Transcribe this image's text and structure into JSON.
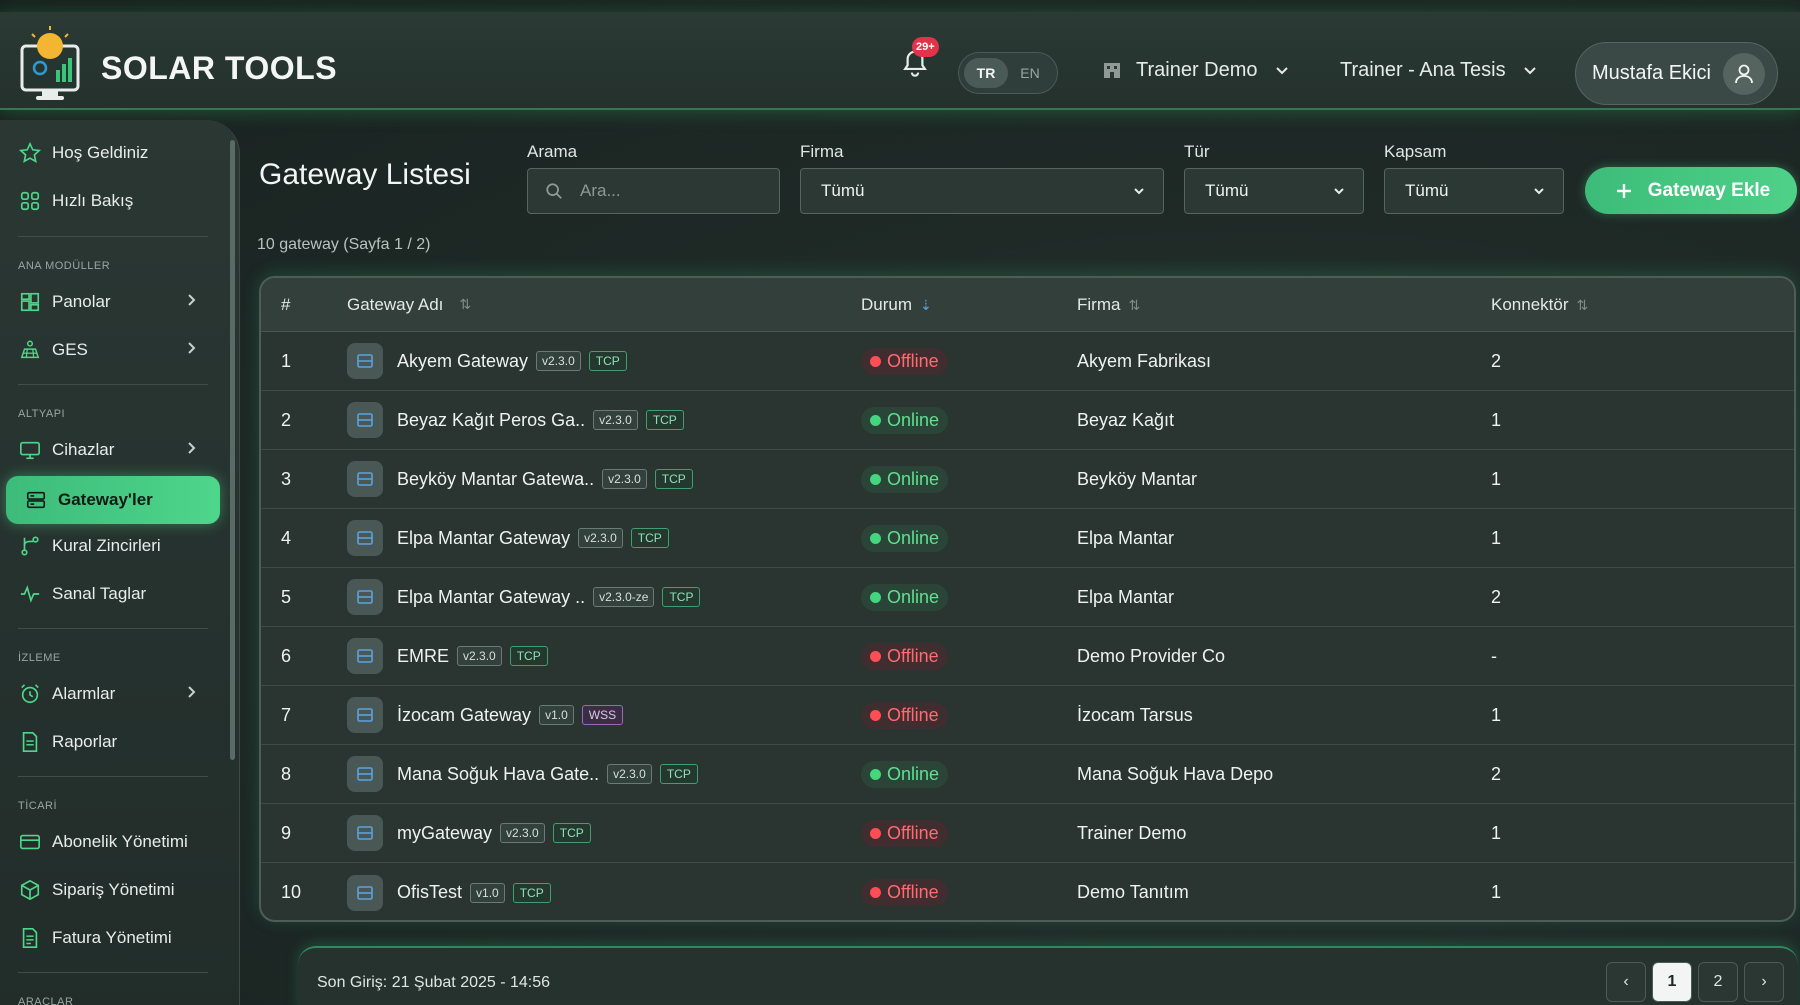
{
  "app": {
    "title": "SOLAR TOOLS"
  },
  "header": {
    "notification_count": "29+",
    "lang": {
      "tr": "TR",
      "en": "EN",
      "active": "TR"
    },
    "company": "Trainer Demo",
    "site": "Trainer - Ana Tesis",
    "user": "Mustafa Ekici"
  },
  "sidebar": {
    "top": [
      {
        "label": "Hoş Geldiniz",
        "icon": "star-icon"
      },
      {
        "label": "Hızlı Bakış",
        "icon": "grid-icon"
      }
    ],
    "sections": {
      "ana": "ANA MODÜLLER",
      "altyapi": "ALTYAPI",
      "izleme": "İZLEME",
      "ticari": "TİCARİ",
      "araclar": "ARAÇLAR"
    },
    "items": {
      "panolar": "Panolar",
      "ges": "GES",
      "cihazlar": "Cihazlar",
      "gateways": "Gateway'ler",
      "kural": "Kural Zincirleri",
      "sanal": "Sanal Taglar",
      "alarmlar": "Alarmlar",
      "raporlar": "Raporlar",
      "abonelik": "Abonelik Yönetimi",
      "siparis": "Sipariş Yönetimi",
      "fatura": "Fatura Yönetimi"
    }
  },
  "main": {
    "title": "Gateway Listesi",
    "count_text": "10 gateway (Sayfa 1 / 2)",
    "filters": {
      "search_label": "Arama",
      "search_placeholder": "Ara...",
      "firma_label": "Firma",
      "firma_value": "Tümü",
      "tur_label": "Tür",
      "tur_value": "Tümü",
      "kapsam_label": "Kapsam",
      "kapsam_value": "Tümü"
    },
    "add_button": "Gateway Ekle"
  },
  "table": {
    "headers": {
      "num": "#",
      "name": "Gateway Adı",
      "status": "Durum",
      "firm": "Firma",
      "conn": "Konnektör"
    },
    "rows": [
      {
        "num": "1",
        "name": "Akyem Gateway",
        "version": "v2.3.0",
        "protocol": "TCP",
        "status": "Offline",
        "firm": "Akyem Fabrikası",
        "conn": "2"
      },
      {
        "num": "2",
        "name": "Beyaz Kağıt Peros Ga..",
        "version": "v2.3.0",
        "protocol": "TCP",
        "status": "Online",
        "firm": "Beyaz Kağıt",
        "conn": "1"
      },
      {
        "num": "3",
        "name": "Beyköy Mantar Gatewa..",
        "version": "v2.3.0",
        "protocol": "TCP",
        "status": "Online",
        "firm": "Beyköy Mantar",
        "conn": "1"
      },
      {
        "num": "4",
        "name": "Elpa Mantar Gateway",
        "version": "v2.3.0",
        "protocol": "TCP",
        "status": "Online",
        "firm": "Elpa Mantar",
        "conn": "1"
      },
      {
        "num": "5",
        "name": "Elpa Mantar Gateway ..",
        "version": "v2.3.0-ze",
        "protocol": "TCP",
        "status": "Online",
        "firm": "Elpa Mantar",
        "conn": "2"
      },
      {
        "num": "6",
        "name": "EMRE",
        "version": "v2.3.0",
        "protocol": "TCP",
        "status": "Offline",
        "firm": "Demo Provider Co",
        "conn": "-"
      },
      {
        "num": "7",
        "name": "İzocam Gateway",
        "version": "v1.0",
        "protocol": "WSS",
        "status": "Offline",
        "firm": "İzocam Tarsus",
        "conn": "1"
      },
      {
        "num": "8",
        "name": "Mana Soğuk Hava Gate..",
        "version": "v2.3.0",
        "protocol": "TCP",
        "status": "Online",
        "firm": "Mana Soğuk Hava Depo",
        "conn": "2"
      },
      {
        "num": "9",
        "name": "myGateway",
        "version": "v2.3.0",
        "protocol": "TCP",
        "status": "Offline",
        "firm": "Trainer Demo",
        "conn": "1"
      },
      {
        "num": "10",
        "name": "OfisTest",
        "version": "v1.0",
        "protocol": "TCP",
        "status": "Offline",
        "firm": "Demo Tanıtım",
        "conn": "1"
      }
    ]
  },
  "footer": {
    "last_login": "Son Giriş: 21 Şubat 2025 - 14:56",
    "pages": [
      "1",
      "2"
    ],
    "current_page": "1",
    "prev": "‹",
    "next": "›"
  },
  "colors": {
    "accent": "#4ed68b",
    "online": "#43d67e",
    "offline": "#ff4d55"
  }
}
